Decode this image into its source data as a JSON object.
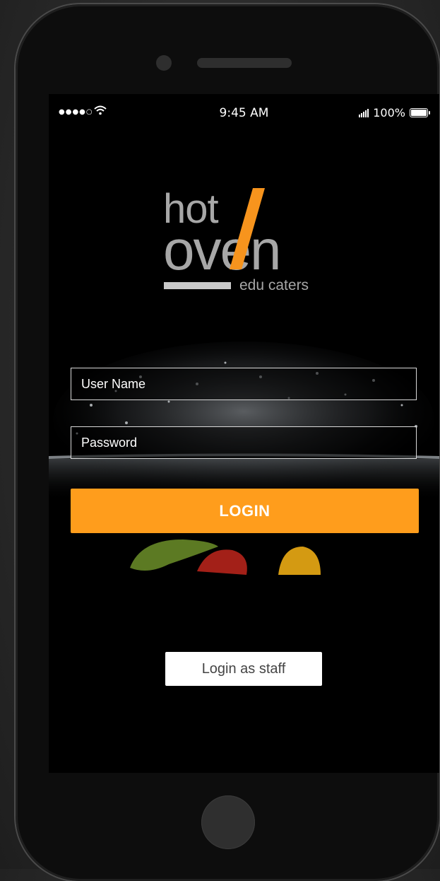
{
  "status_bar": {
    "signal_dots": "●●●●○",
    "time": "9:45 AM",
    "battery_text": "100%"
  },
  "logo": {
    "word_top": "hot",
    "word_bottom": "oven",
    "tagline": "edu caters",
    "accent_color": "#f7941d",
    "text_color": "#a7a7a7"
  },
  "form": {
    "username_placeholder": "User Name",
    "password_placeholder": "Password",
    "login_label": "LOGIN",
    "staff_label": "Login as staff"
  },
  "colors": {
    "primary": "#ff9d1c",
    "background": "#000000"
  }
}
